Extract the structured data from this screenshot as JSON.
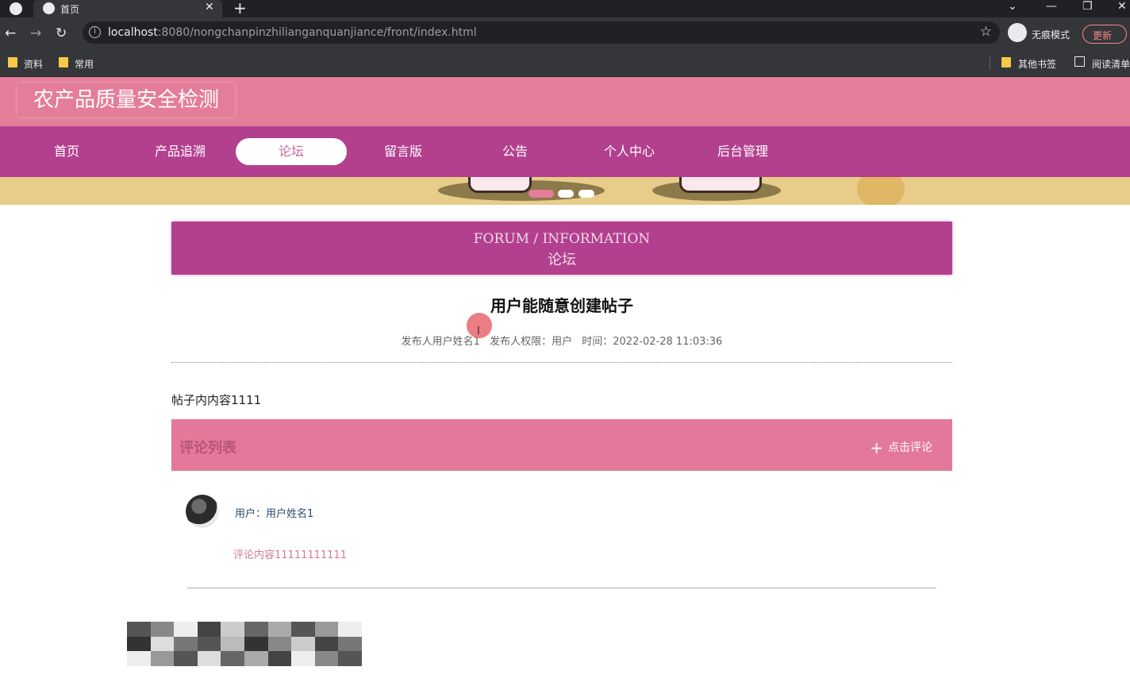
{
  "browser": {
    "tab_title": "首页",
    "url_host": "localhost",
    "url_rest": ":8080/nongchanpinzhilianganquanjiance/front/index.html",
    "incognito_label": "无痕模式",
    "update_label": "更新",
    "bookmarks": [
      "资料",
      "常用"
    ],
    "bookmarks_right": [
      "其他书签",
      "阅读清单"
    ]
  },
  "site": {
    "title": "农产品质量安全检测",
    "nav": [
      "首页",
      "产品追溯",
      "论坛",
      "留言版",
      "公告",
      "个人中心",
      "后台管理"
    ],
    "active_nav": "论坛"
  },
  "section": {
    "title_en": "FORUM / INFORMATION",
    "title_cn": "论坛"
  },
  "post": {
    "title": "用户能随意创建帖子",
    "author": "发布人用户姓名1",
    "role": "发布人权限：用户",
    "time": "时间：2022-02-28 11:03:36",
    "content": "帖子内内容1111"
  },
  "comments": {
    "header": "评论列表",
    "add_label": "点击评论",
    "items": [
      {
        "user": "用户：用户姓名1",
        "text": "评论内容11111111111"
      }
    ]
  },
  "colors": {
    "header_pink": "#e47d99",
    "nav_magenta": "#b3408f",
    "comment_bar": "#e4789a"
  }
}
